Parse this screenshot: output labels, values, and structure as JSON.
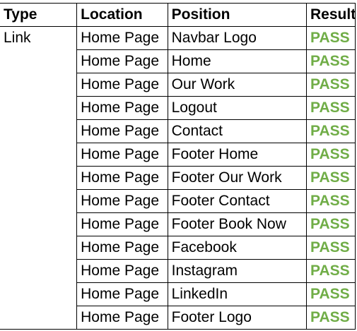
{
  "table": {
    "headers": [
      "Type",
      "Location",
      "Position",
      "Result"
    ],
    "rows": [
      {
        "type": "Link",
        "location": "Home Page",
        "position": "Navbar Logo",
        "result": "PASS"
      },
      {
        "type": "",
        "location": "Home Page",
        "position": "Home",
        "result": "PASS"
      },
      {
        "type": "",
        "location": "Home Page",
        "position": "Our Work",
        "result": "PASS"
      },
      {
        "type": "",
        "location": "Home Page",
        "position": "Logout",
        "result": "PASS"
      },
      {
        "type": "",
        "location": "Home Page",
        "position": "Contact",
        "result": "PASS"
      },
      {
        "type": "",
        "location": "Home Page",
        "position": "Footer Home",
        "result": "PASS"
      },
      {
        "type": "",
        "location": "Home Page",
        "position": "Footer Our Work",
        "result": "PASS"
      },
      {
        "type": "",
        "location": "Home Page",
        "position": "Footer Contact",
        "result": "PASS"
      },
      {
        "type": "",
        "location": "Home Page",
        "position": "Footer Book Now",
        "result": "PASS"
      },
      {
        "type": "",
        "location": "Home Page",
        "position": "Facebook",
        "result": "PASS"
      },
      {
        "type": "",
        "location": "Home Page",
        "position": "Instagram",
        "result": "PASS"
      },
      {
        "type": "",
        "location": "Home Page",
        "position": "LinkedIn",
        "result": "PASS"
      },
      {
        "type": "",
        "location": "Home Page",
        "position": "Footer Logo",
        "result": "PASS"
      }
    ]
  },
  "colors": {
    "pass": "#70ad47",
    "border": "#000000"
  }
}
